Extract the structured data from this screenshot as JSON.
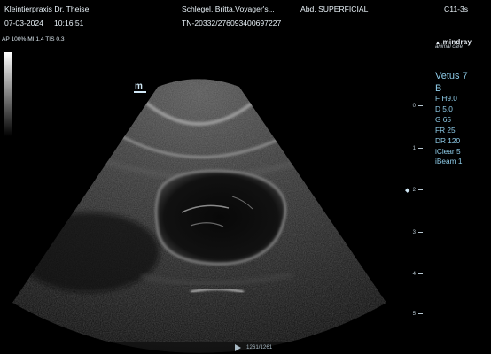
{
  "header": {
    "clinic": "Kleintierpraxis Dr. Theise",
    "date": "07-03-2024",
    "time": "10:16:51",
    "patient": "Schlegel, Britta,Voyager's...",
    "patient_id": "TN-20332/276093400697227",
    "exam": "Abd. SUPERFICIAL",
    "probe": "C11-3s",
    "acoustic": "AP 100%  MI 1.4 TIS 0.3"
  },
  "logo": {
    "brand": "mindray",
    "sub": "animal care"
  },
  "side_panel": {
    "preset": "Vetus 7",
    "mode": "B",
    "params": [
      "F H9.0",
      "D 5.0",
      "G 65",
      "FR 25",
      "DR 120",
      "iClear 5",
      "iBeam 1"
    ]
  },
  "orientation_marker": "m",
  "depth_scale": [
    "0",
    "1",
    "2",
    "3",
    "4",
    "5"
  ],
  "focus_marker": "◆",
  "cine": {
    "frame": "1261/1261"
  }
}
